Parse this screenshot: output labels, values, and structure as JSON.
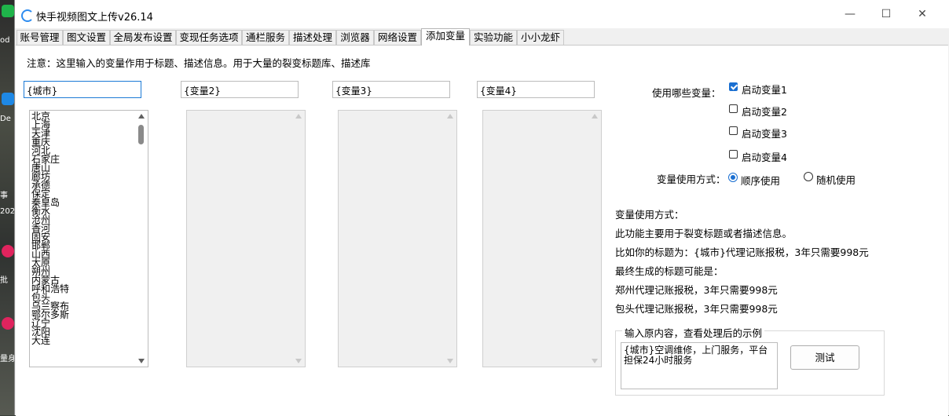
{
  "window": {
    "title": "快手视频图文上传v26.14"
  },
  "desktop": {
    "labels": [
      "od",
      "De",
      "事",
      "202",
      "批",
      "量身"
    ]
  },
  "tabs": [
    "账号管理",
    "图文设置",
    "全局发布设置",
    "变现任务选项",
    "通栏服务",
    "描述处理",
    "浏览器",
    "网络设置",
    "添加变量",
    "实验功能",
    "小小龙虾"
  ],
  "active_tab": "添加变量",
  "note": "注意：这里输入的变量作用于标题、描述信息。用于大量的裂变标题库、描述库",
  "variables": [
    {
      "name": "{城市}",
      "enabled": true,
      "items": [
        "北京",
        "上海",
        "天津",
        "重庆",
        "河北",
        "石家庄",
        "唐山",
        "廊坊",
        "承德",
        "保定",
        "秦皇岛",
        "衡水",
        "沧州",
        "香河",
        "固安",
        "邯郸",
        "山西",
        "太原",
        "朔州",
        "内蒙古",
        "呼和浩特",
        "包头",
        "乌兰察布",
        "鄂尔多斯",
        "辽宁",
        "沈阳",
        "大连"
      ]
    },
    {
      "name": "{变量2}",
      "enabled": false,
      "items": []
    },
    {
      "name": "{变量3}",
      "enabled": false,
      "items": []
    },
    {
      "name": "{变量4}",
      "enabled": false,
      "items": []
    }
  ],
  "options": {
    "which_label": "使用哪些变量：",
    "checkboxes": [
      "启动变量1",
      "启动变量2",
      "启动变量3",
      "启动变量4"
    ],
    "mode_label": "变量使用方式：",
    "mode_options": [
      "顺序使用",
      "随机使用"
    ],
    "mode_selected": "顺序使用"
  },
  "help": [
    "变量使用方式：",
    "此功能主要用于裂变标题或者描述信息。",
    "比如你的标题为：{城市}代理记账报税，3年只需要998元",
    "最终生成的标题可能是：",
    "郑州代理记账报税，3年只需要998元",
    "包头代理记账报税，3年只需要998元"
  ],
  "example": {
    "title": "输入原内容，查看处理后的示例",
    "input": "{城市}空调维修，上门服务，平台担保24小时服务",
    "button": "测试"
  },
  "colors": {
    "accent": "#1a6fd1"
  }
}
